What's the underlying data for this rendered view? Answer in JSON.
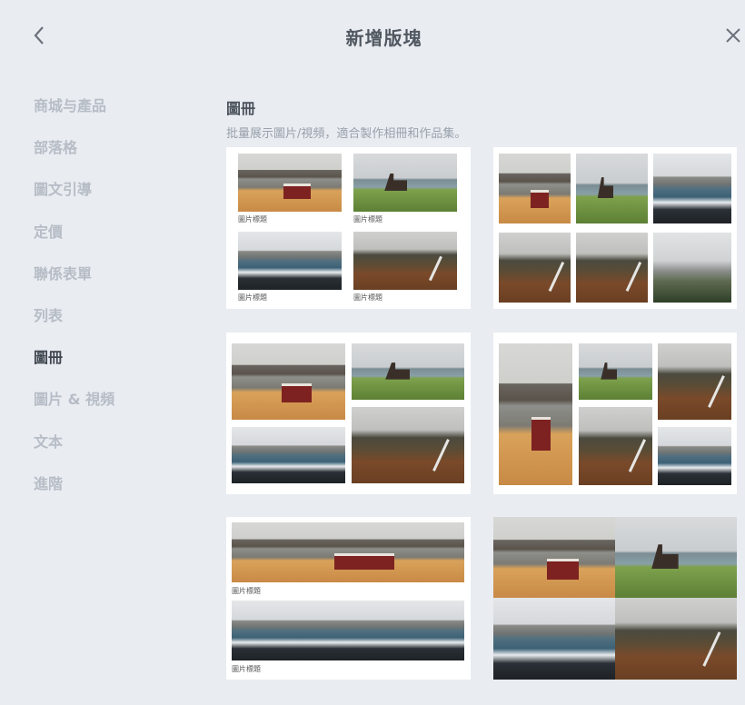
{
  "header": {
    "title": "新增版塊",
    "back_icon": "chevron-left-icon",
    "close_icon": "close-icon"
  },
  "nav": {
    "items": [
      "商城与產品",
      "部落格",
      "圖文引導",
      "定價",
      "聯係表單",
      "列表",
      "圖冊",
      "圖片 & 視頻",
      "文本",
      "進階"
    ],
    "active_index": 6
  },
  "section": {
    "title": "圖冊",
    "description": "批量展示圖片/視頻，適合製作相冊和作品集。"
  },
  "caption": "圖片標題",
  "colors": {
    "background": "#e9ecf1",
    "active_text": "#3f454e",
    "inactive_text": "#b7bdc6"
  }
}
